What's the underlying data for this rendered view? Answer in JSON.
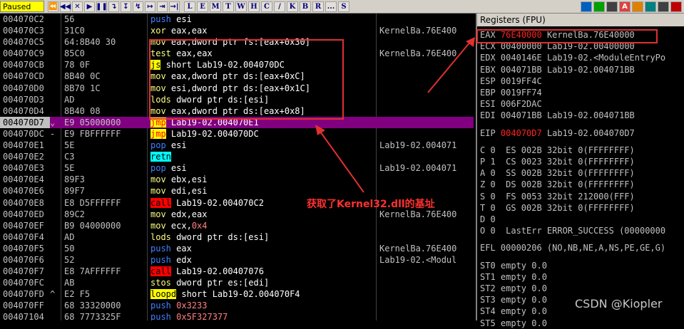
{
  "toolbar": {
    "status": "Paused",
    "buttons": [
      "⏪",
      "◀◀",
      "✕",
      "▶",
      "❚❚",
      "↴",
      "↧",
      "↯",
      "↦",
      "⇥",
      "→|"
    ],
    "letters": [
      "L",
      "E",
      "M",
      "T",
      "W",
      "H",
      "C",
      "/",
      "K",
      "B",
      "R",
      "...",
      "S"
    ],
    "right_icons": [
      "list-icon",
      "table-icon",
      "refresh-icon",
      "A",
      "stop-icon",
      "target-icon",
      "gear-icon",
      "question-icon"
    ]
  },
  "disasm": [
    {
      "addr": "004070C2",
      "mark": "",
      "hex": "56",
      "asm": [
        {
          "k": "push",
          "c": "k-push"
        },
        {
          "t": " esi",
          "c": "txt"
        }
      ],
      "com": ""
    },
    {
      "addr": "004070C3",
      "mark": "",
      "hex": "31C0",
      "asm": [
        {
          "k": "xor",
          "c": "k-xor"
        },
        {
          "t": " eax,eax",
          "c": "txt"
        }
      ],
      "com": "KernelBa.76E400"
    },
    {
      "addr": "004070C5",
      "mark": "",
      "hex": "64:8B40 30",
      "asm": [
        {
          "k": "mov",
          "c": "k-mov"
        },
        {
          "t": " eax,dword ptr fs:[eax+0x30]",
          "c": "txt"
        }
      ],
      "com": ""
    },
    {
      "addr": "004070C9",
      "mark": "",
      "hex": "85C0",
      "asm": [
        {
          "k": "test",
          "c": "k-test"
        },
        {
          "t": " eax,eax",
          "c": "txt"
        }
      ],
      "com": "KernelBa.76E400"
    },
    {
      "addr": "004070CB",
      "mark": "",
      "hex": "78 0F",
      "asm": [
        {
          "k": "js",
          "c": "k-js"
        },
        {
          "t": " short Lab19-02.004070DC",
          "c": "txt"
        }
      ],
      "com": ""
    },
    {
      "addr": "004070CD",
      "mark": "",
      "hex": "8B40 0C",
      "asm": [
        {
          "k": "mov",
          "c": "k-mov"
        },
        {
          "t": " eax,dword ptr ds:[eax+0xC]",
          "c": "txt"
        }
      ],
      "com": ""
    },
    {
      "addr": "004070D0",
      "mark": "",
      "hex": "8B70 1C",
      "asm": [
        {
          "k": "mov",
          "c": "k-mov"
        },
        {
          "t": " esi,dword ptr ds:[eax+0x1C]",
          "c": "txt"
        }
      ],
      "com": ""
    },
    {
      "addr": "004070D3",
      "mark": "",
      "hex": "AD",
      "asm": [
        {
          "k": "lods",
          "c": "k-lods"
        },
        {
          "t": " dword ptr ds:[esi]",
          "c": "txt"
        }
      ],
      "com": ""
    },
    {
      "addr": "004070D4",
      "mark": "",
      "hex": "8B40 08",
      "asm": [
        {
          "k": "mov",
          "c": "k-mov"
        },
        {
          "t": " eax,dword ptr ds:[eax+0x8]",
          "c": "txt"
        }
      ],
      "com": ""
    },
    {
      "addr": "004070D7",
      "mark": "⌄",
      "hex": "E9 05000000",
      "asm": [
        {
          "k": "jmp",
          "c": "k-jmp"
        },
        {
          "t": " Lab19-02.004070E1",
          "c": "txt"
        }
      ],
      "com": "",
      "hl": true
    },
    {
      "addr": "004070DC",
      "mark": "-",
      "hex": "E9 FBFFFFFF",
      "asm": [
        {
          "k": "jmp",
          "c": "k-jmp"
        },
        {
          "t": " Lab19-02.004070DC",
          "c": "txt"
        }
      ],
      "com": ""
    },
    {
      "addr": "004070E1",
      "mark": "",
      "hex": "5E",
      "asm": [
        {
          "k": "pop",
          "c": "k-pop"
        },
        {
          "t": " esi",
          "c": "txt"
        }
      ],
      "com": "Lab19-02.004071"
    },
    {
      "addr": "004070E2",
      "mark": "",
      "hex": "C3",
      "asm": [
        {
          "k": "retn",
          "c": "k-retn"
        }
      ],
      "com": ""
    },
    {
      "addr": "004070E3",
      "mark": "",
      "hex": "5E",
      "asm": [
        {
          "k": "pop",
          "c": "k-pop"
        },
        {
          "t": " esi",
          "c": "txt"
        }
      ],
      "com": "Lab19-02.004071"
    },
    {
      "addr": "004070E4",
      "mark": "",
      "hex": "89F3",
      "asm": [
        {
          "k": "mov",
          "c": "k-mov"
        },
        {
          "t": " ebx,esi",
          "c": "txt"
        }
      ],
      "com": ""
    },
    {
      "addr": "004070E6",
      "mark": "",
      "hex": "89F7",
      "asm": [
        {
          "k": "mov",
          "c": "k-mov"
        },
        {
          "t": " edi,esi",
          "c": "txt"
        }
      ],
      "com": ""
    },
    {
      "addr": "004070E8",
      "mark": "",
      "hex": "E8 D5FFFFFF",
      "asm": [
        {
          "k": "call",
          "c": "k-call"
        },
        {
          "t": " Lab19-02.004070C2",
          "c": "txt"
        }
      ],
      "com": ""
    },
    {
      "addr": "004070ED",
      "mark": "",
      "hex": "89C2",
      "asm": [
        {
          "k": "mov",
          "c": "k-mov"
        },
        {
          "t": " edx,eax",
          "c": "txt"
        }
      ],
      "com": "KernelBa.76E400"
    },
    {
      "addr": "004070EF",
      "mark": "",
      "hex": "B9 04000000",
      "asm": [
        {
          "k": "mov",
          "c": "k-mov"
        },
        {
          "t": " ecx,",
          "c": "txt"
        },
        {
          "t": "0x4",
          "c": "num"
        }
      ],
      "com": ""
    },
    {
      "addr": "004070F4",
      "mark": "",
      "hex": "AD",
      "asm": [
        {
          "k": "lods",
          "c": "k-lods"
        },
        {
          "t": " dword ptr ds:[esi]",
          "c": "txt"
        }
      ],
      "com": ""
    },
    {
      "addr": "004070F5",
      "mark": "",
      "hex": "50",
      "asm": [
        {
          "k": "push",
          "c": "k-push"
        },
        {
          "t": " eax",
          "c": "txt"
        }
      ],
      "com": "KernelBa.76E400"
    },
    {
      "addr": "004070F6",
      "mark": "",
      "hex": "52",
      "asm": [
        {
          "k": "push",
          "c": "k-push"
        },
        {
          "t": " edx",
          "c": "txt"
        }
      ],
      "com": "Lab19-02.<Modul"
    },
    {
      "addr": "004070F7",
      "mark": "",
      "hex": "E8 7AFFFFFF",
      "asm": [
        {
          "k": "call",
          "c": "k-call"
        },
        {
          "t": " Lab19-02.00407076",
          "c": "txt"
        }
      ],
      "com": ""
    },
    {
      "addr": "004070FC",
      "mark": "",
      "hex": "AB",
      "asm": [
        {
          "k": "stos",
          "c": "k-stos"
        },
        {
          "t": " dword ptr es:[edi]",
          "c": "txt"
        }
      ],
      "com": ""
    },
    {
      "addr": "004070FD",
      "mark": "^",
      "hex": "E2 F5",
      "asm": [
        {
          "k": "loopd",
          "c": "k-loopd"
        },
        {
          "t": " short Lab19-02.004070F4",
          "c": "txt"
        }
      ],
      "com": ""
    },
    {
      "addr": "004070FF",
      "mark": "",
      "hex": "68 33320000",
      "asm": [
        {
          "k": "push",
          "c": "k-push"
        },
        {
          "t": " 0x3233",
          "c": "num"
        }
      ],
      "com": ""
    },
    {
      "addr": "00407104",
      "mark": "",
      "hex": "68 7773325F",
      "asm": [
        {
          "k": "push",
          "c": "k-push"
        },
        {
          "t": " 0x5F327377",
          "c": "num"
        }
      ],
      "com": ""
    }
  ],
  "registers": {
    "title": "Registers (FPU)",
    "rows": [
      {
        "n": "EAX",
        "v": "76E40000",
        "d": "KernelBa.76E40000",
        "chg": true
      },
      {
        "n": "ECX",
        "v": "00400000",
        "d": "Lab19-02.00400000"
      },
      {
        "n": "EDX",
        "v": "0040146E",
        "d": "Lab19-02.<ModuleEntryPo"
      },
      {
        "n": "EBX",
        "v": "004071BB",
        "d": "Lab19-02.004071BB"
      },
      {
        "n": "ESP",
        "v": "0019FF4C",
        "d": ""
      },
      {
        "n": "EBP",
        "v": "0019FF74",
        "d": ""
      },
      {
        "n": "ESI",
        "v": "006F2DAC",
        "d": ""
      },
      {
        "n": "EDI",
        "v": "004071BB",
        "d": "Lab19-02.004071BB"
      },
      {
        "n": "",
        "v": "",
        "d": ""
      },
      {
        "n": "EIP",
        "v": "004070D7",
        "d": "Lab19-02.004070D7",
        "chg": true
      }
    ],
    "flags": [
      "C 0  ES 002B 32bit 0(FFFFFFFF)",
      "P 1  CS 0023 32bit 0(FFFFFFFF)",
      "A 0  SS 002B 32bit 0(FFFFFFFF)",
      "Z 0  DS 002B 32bit 0(FFFFFFFF)",
      "S 0  FS 0053 32bit 212000(FFF)",
      "T 0  GS 002B 32bit 0(FFFFFFFF)",
      "D 0",
      "O 0  LastErr ERROR_SUCCESS (00000000",
      "",
      "EFL 00000206 (NO,NB,NE,A,NS,PE,GE,G)",
      "",
      "ST0 empty 0.0",
      "ST1 empty 0.0",
      "ST2 empty 0.0",
      "ST3 empty 0.0",
      "ST4 empty 0.0",
      "ST5 empty 0.0"
    ]
  },
  "annotation": "获取了Kernel32.dll的基址",
  "watermark": "CSDN @Kiopler",
  "colors": {
    "highlight": "#800080",
    "annotation": "#e03030"
  }
}
